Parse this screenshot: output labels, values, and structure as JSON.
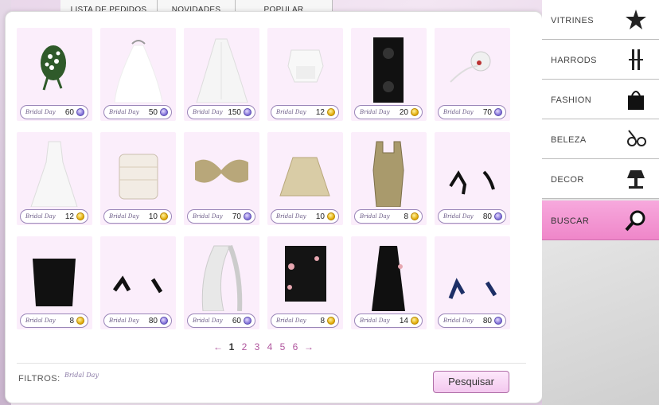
{
  "top_tabs": [
    "LISTA DE PEDIDOS",
    "NOVIDADES",
    "POPULAR"
  ],
  "items": [
    {
      "price": "60",
      "currency": "purple",
      "brand": "Bridal Day",
      "kind": "bouquet"
    },
    {
      "price": "50",
      "currency": "purple",
      "brand": "Bridal Day",
      "kind": "veil"
    },
    {
      "price": "150",
      "currency": "purple",
      "brand": "Bridal Day",
      "kind": "long-veil"
    },
    {
      "price": "12",
      "currency": "gold",
      "brand": "Bridal Day",
      "kind": "top"
    },
    {
      "price": "20",
      "currency": "gold",
      "brand": "Bridal Day",
      "kind": "speakers"
    },
    {
      "price": "70",
      "currency": "purple",
      "brand": "Bridal Day",
      "kind": "fascinator"
    },
    {
      "price": "12",
      "currency": "gold",
      "brand": "Bridal Day",
      "kind": "gown"
    },
    {
      "price": "10",
      "currency": "gold",
      "brand": "Bridal Day",
      "kind": "corset"
    },
    {
      "price": "70",
      "currency": "purple",
      "brand": "Bridal Day",
      "kind": "bow"
    },
    {
      "price": "10",
      "currency": "gold",
      "brand": "Bridal Day",
      "kind": "skirt"
    },
    {
      "price": "8",
      "currency": "gold",
      "brand": "Bridal Day",
      "kind": "tank"
    },
    {
      "price": "80",
      "currency": "purple",
      "brand": "Bridal Day",
      "kind": "heels"
    },
    {
      "price": "8",
      "currency": "gold",
      "brand": "Bridal Day",
      "kind": "black-top"
    },
    {
      "price": "80",
      "currency": "purple",
      "brand": "Bridal Day",
      "kind": "black-heels"
    },
    {
      "price": "60",
      "currency": "purple",
      "brand": "Bridal Day",
      "kind": "scarf"
    },
    {
      "price": "8",
      "currency": "gold",
      "brand": "Bridal Day",
      "kind": "floral-skirt"
    },
    {
      "price": "14",
      "currency": "gold",
      "brand": "Bridal Day",
      "kind": "long-skirt"
    },
    {
      "price": "80",
      "currency": "purple",
      "brand": "Bridal Day",
      "kind": "blue-heels"
    }
  ],
  "pagination": {
    "prev": "←",
    "next": "→",
    "pages": [
      "1",
      "2",
      "3",
      "4",
      "5",
      "6"
    ],
    "current": "1"
  },
  "filters": {
    "label": "FILTROS:",
    "brand": "Bridal Day"
  },
  "search_button": "Pesquisar",
  "menu": [
    {
      "label": "VITRINES",
      "icon": "star-icon"
    },
    {
      "label": "HARRODS",
      "icon": "harrods-icon"
    },
    {
      "label": "FASHION",
      "icon": "shopping-bag-icon"
    },
    {
      "label": "BELEZA",
      "icon": "sunglasses-icon"
    },
    {
      "label": "DECOR",
      "icon": "table-lamp-icon"
    },
    {
      "label": "BUSCAR",
      "icon": "magnifier-icon",
      "active": true
    }
  ],
  "colors": {
    "accent": "#b0569e",
    "active_menu": "#ef86c9",
    "card_bg": "#fbeefb"
  }
}
